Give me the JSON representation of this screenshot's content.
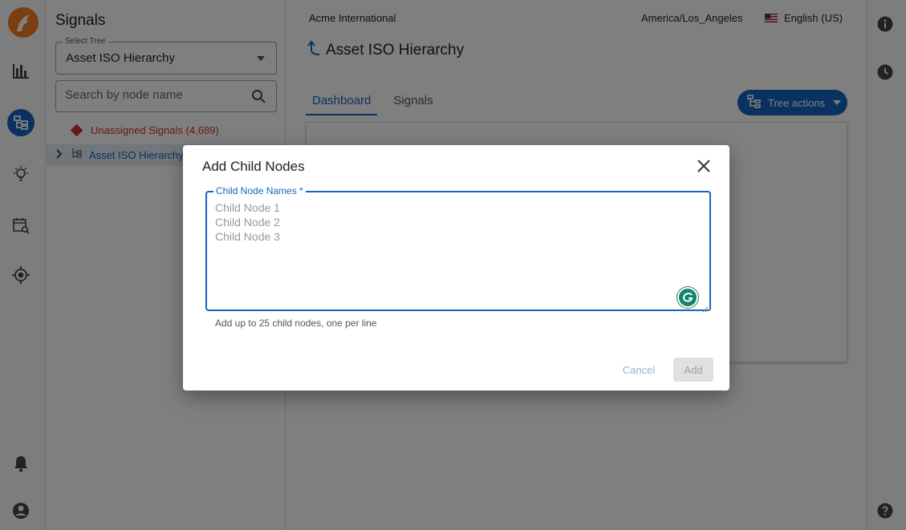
{
  "colors": {
    "accent": "#1565c0",
    "logo": "#f57c20",
    "error": "#d32f2f",
    "grammarly": "#15846b"
  },
  "rail": {
    "icons": [
      "logo-icon",
      "bar-chart-icon",
      "tree-hierarchy-icon",
      "lightbulb-icon",
      "calendar-search-icon",
      "crosshair-icon",
      "bell-icon",
      "account-icon"
    ]
  },
  "sidebar": {
    "title": "Signals",
    "select_tree": {
      "label": "Select Tree",
      "value": "Asset ISO Hierarchy"
    },
    "search": {
      "placeholder": "Search by node name"
    },
    "unassigned": "Unassigned Signals (4,689)",
    "tree_item": "Asset ISO Hierarchy"
  },
  "topbar": {
    "company": "Acme International",
    "timezone": "America/Los_Angeles",
    "language": "English (US)"
  },
  "main": {
    "title": "Asset ISO Hierarchy",
    "tabs": [
      {
        "label": "Dashboard",
        "active": true
      },
      {
        "label": "Signals",
        "active": false
      }
    ],
    "tree_actions": "Tree actions"
  },
  "right_rail": {
    "icons": [
      "info-icon",
      "history-icon",
      "help-icon"
    ]
  },
  "modal": {
    "title": "Add Child Nodes",
    "field_label": "Child Node Names *",
    "placeholder": "Child Node 1\nChild Node 2\nChild Node 3",
    "value": "",
    "helper": "Add up to 25 child nodes, one per line",
    "cancel": "Cancel",
    "add": "Add"
  }
}
